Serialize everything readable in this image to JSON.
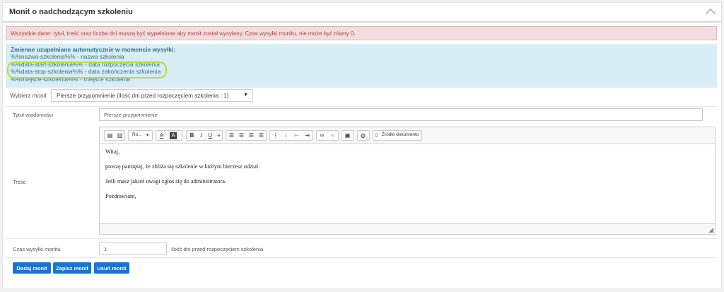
{
  "panel": {
    "title": "Monit o nadchodzącym szkoleniu"
  },
  "alert": {
    "text": "Wszystkie dane: tytuł, treść oraz liczba dni muszą być wypełnione aby monit został wysyłany. Czas wysyłki monitu, nie może być równy 0."
  },
  "variables": {
    "heading": "Zmienne uzupełniane automatycznie w momencie wysyłki:",
    "items": [
      "%%nazwa-szkolenia%% - nazwa szkolenia",
      "%%data-start-szkolenia%% - data rozpoczęcia szkolenia",
      "%%data-stop-szkolenia%% - data zakończenia szkolenia",
      "%%miejsce-szkolenia%% - miejsce szkolenia"
    ]
  },
  "select_reminder": {
    "label": "Wybierz monit",
    "value": "Piersze przypomnienie (ilość dni przed rozpoczęciem szkolenia : 1)"
  },
  "title_field": {
    "label": "Tytuł wiadomości",
    "value": "Piersze przypomnienie"
  },
  "content_field": {
    "label": "Treść"
  },
  "toolbar": {
    "font": "Ro...",
    "source": "Źródło dokumentu"
  },
  "body": {
    "lines": [
      "Witaj,",
      "proszę pamiętaj, że zbliża się szkolenie w którym bierzesz udział.",
      "Jeśli masz jakieś uwagi zgłoś się do administratora.",
      "Pozdrawiam,"
    ]
  },
  "send_time": {
    "label": "Czas wysyłki monitu",
    "value": "1",
    "suffix": "Ilość dni przed rozpoczęciem szkolenia"
  },
  "buttons": {
    "add": "Dodaj monit",
    "save": "Zapisz monit",
    "delete": "Usuń monit"
  },
  "colors": {
    "primary": "#1a73d4",
    "danger_bg": "#f2dede",
    "info_bg": "#d9edf7",
    "highlight": "#b6e02b"
  }
}
